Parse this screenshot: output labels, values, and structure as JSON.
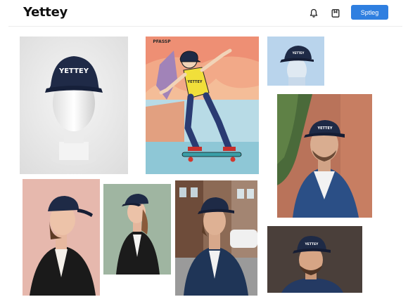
{
  "header": {
    "brand": "Yettey",
    "cta_label": "Sptleg",
    "icons": [
      "bell-icon",
      "bookmark-icon"
    ]
  },
  "colors": {
    "accent": "#2f7fe0",
    "cap_navy": "#1e2a46"
  },
  "gallery": {
    "cap_text": "YETTEY",
    "comic_sign": "PFASSP",
    "comic_shirt_text": "YETTEY",
    "tiles": [
      {
        "name": "photo-cap-on-mannequin"
      },
      {
        "name": "photo-comic-skateboarder"
      },
      {
        "name": "photo-cap-blue-backdrop"
      },
      {
        "name": "photo-man-brick-wall"
      },
      {
        "name": "photo-woman-pink-backdrop"
      },
      {
        "name": "photo-woman-green-backdrop"
      },
      {
        "name": "photo-man-city-street"
      },
      {
        "name": "photo-man-dark-backdrop"
      }
    ]
  }
}
